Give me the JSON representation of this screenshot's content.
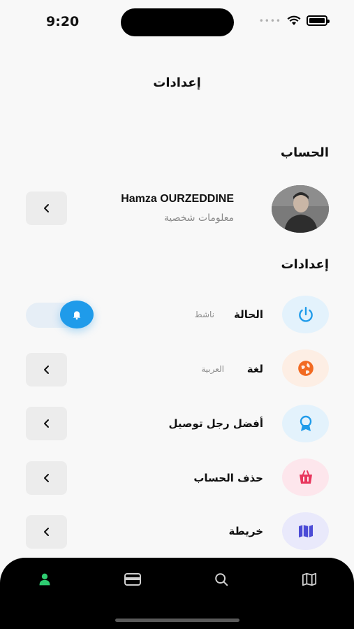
{
  "status_bar": {
    "time": "9:20"
  },
  "header": {
    "title": "إعدادات"
  },
  "account_section": {
    "title": "الحساب",
    "name": "Hamza OURZEDDINE",
    "subtitle": "معلومات شخصية"
  },
  "settings_section": {
    "title": "إعدادات",
    "items": [
      {
        "label": "الحالة",
        "value": "ناشط",
        "icon": "power-icon",
        "icon_color": "#1f9bea",
        "icon_bg": "#e3f2fc",
        "toggle_on": true
      },
      {
        "label": "لغة",
        "value": "العربية",
        "icon": "language-icon",
        "icon_color": "#f26a21",
        "icon_bg": "#fdeee4"
      },
      {
        "label": "أفضل رجل توصيل",
        "icon": "award-icon",
        "icon_color": "#1f9bea",
        "icon_bg": "#e3f2fc"
      },
      {
        "label": "حذف الحساب",
        "icon": "trash-icon",
        "icon_color": "#e8365d",
        "icon_bg": "#fde6ec"
      },
      {
        "label": "خريطة",
        "icon": "map-icon",
        "icon_color": "#4b4bd6",
        "icon_bg": "#e9e9fb"
      }
    ]
  },
  "bottom_nav": {
    "items": [
      {
        "icon": "user-icon",
        "color": "#2ecc71",
        "active": true
      },
      {
        "icon": "wallet-icon",
        "color": "#cfcfcf"
      },
      {
        "icon": "search-icon",
        "color": "#cfcfcf"
      },
      {
        "icon": "map-icon",
        "color": "#cfcfcf"
      }
    ]
  }
}
